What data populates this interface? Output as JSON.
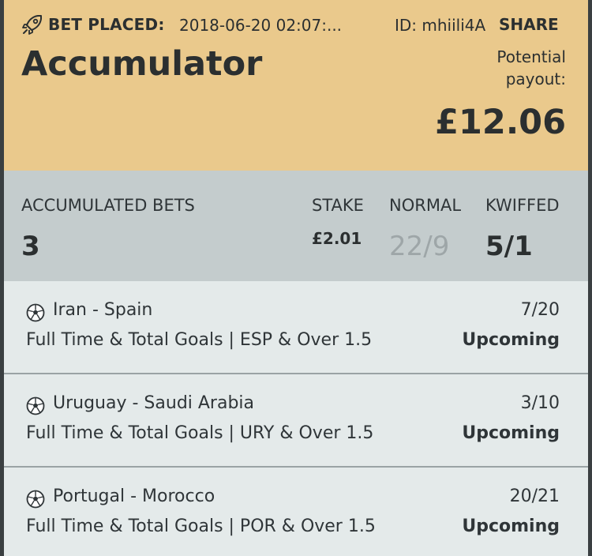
{
  "header": {
    "placed_label": "BET PLACED:",
    "placed_date": "2018-06-20 02:07:...",
    "bet_id": "ID: mhiili4A",
    "share_label": "SHARE",
    "bet_type": "Accumulator",
    "payout_label": "Potential payout:",
    "payout_value": "£12.06"
  },
  "summary": {
    "accumulated_label": "ACCUMULATED BETS",
    "accumulated_value": "3",
    "stake_label": "STAKE",
    "stake_value": "£2.01",
    "normal_label": "NORMAL",
    "normal_value": "22/9",
    "kwiffed_label": "KWIFFED",
    "kwiffed_value": "5/1"
  },
  "legs": [
    {
      "match": "Iran - Spain",
      "odds": "7/20",
      "market": "Full Time & Total Goals | ESP & Over 1.5",
      "status": "Upcoming"
    },
    {
      "match": "Uruguay - Saudi Arabia",
      "odds": "3/10",
      "market": "Full Time & Total Goals | URY & Over 1.5",
      "status": "Upcoming"
    },
    {
      "match": "Portugal - Morocco",
      "odds": "20/21",
      "market": "Full Time & Total Goals | POR & Over 1.5",
      "status": "Upcoming"
    }
  ],
  "colors": {
    "header_bg": "#eac98c",
    "summary_bg": "#c4cccd",
    "leg_bg": "#e4eaea",
    "text": "#2b2f30",
    "muted_odds": "#9ea6a8"
  },
  "icons": {
    "header": "rocket-icon",
    "leg": "soccer-ball-icon"
  }
}
